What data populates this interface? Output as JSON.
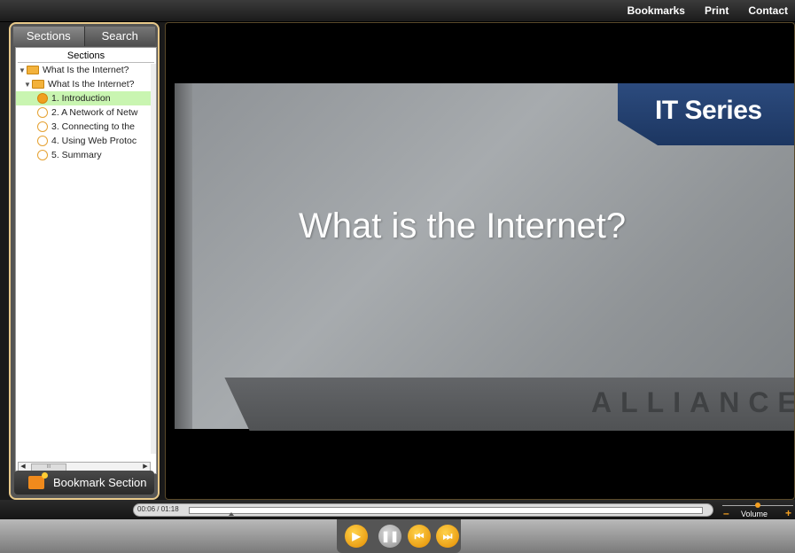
{
  "topbar": {
    "links": [
      "Bookmarks",
      "Print",
      "Contact"
    ]
  },
  "sidebar": {
    "tabs": [
      "Sections",
      "Search"
    ],
    "tree_header": "Sections",
    "tree": [
      {
        "label": "What Is the Internet?",
        "type": "folder",
        "level": 0
      },
      {
        "label": "What Is the Internet?",
        "type": "folder",
        "level": 1
      },
      {
        "label": "1. Introduction",
        "type": "item",
        "state": "current",
        "selected": true
      },
      {
        "label": "2. A Network of Netw",
        "type": "item"
      },
      {
        "label": "3. Connecting to the",
        "type": "item"
      },
      {
        "label": "4. Using Web Protoc",
        "type": "item"
      },
      {
        "label": "5. Summary",
        "type": "item"
      }
    ],
    "bookmark_button": "Bookmark Section"
  },
  "video": {
    "badge": "IT Series",
    "title": "What is the Internet?",
    "watermark": "ALLIANCE"
  },
  "player": {
    "time": "00:06 / 01:18",
    "volume_label": "Volume",
    "volume_minus": "–",
    "volume_plus": "+"
  },
  "colors": {
    "selected_row": "#c9f5b1",
    "accent_orange": "#f0a020",
    "badge_blue": "#1c3661"
  }
}
